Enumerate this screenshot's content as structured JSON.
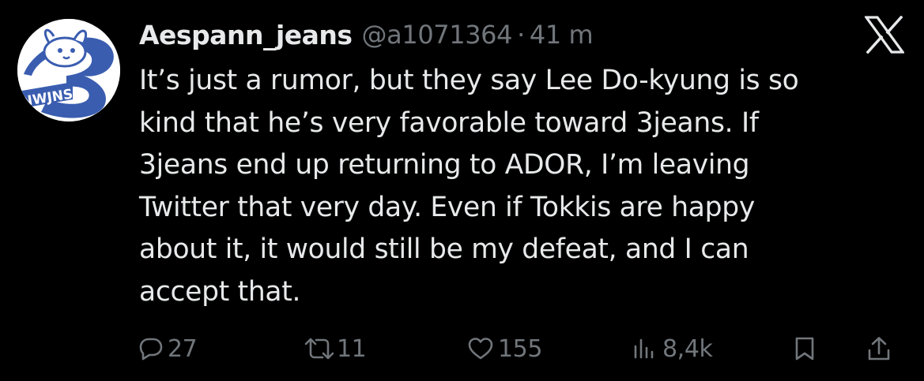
{
  "tweet": {
    "author": {
      "display_name": "Aespann_jeans",
      "handle": "@a1071364",
      "separator": "·",
      "time": "41 m",
      "avatar_icon": "rabbit-logo-avatar",
      "avatar_text": "NWJNS"
    },
    "platform_icon": "x-logo-icon",
    "text": "It’s just a rumor, but they say Lee Do-kyung is so\nkind that he’s very favorable toward 3jeans. If\n3jeans end up returning to ADOR, I’m leaving\nTwitter that very day. Even if Tokkis are happy\nabout it, it would still be my defeat, and I can\naccept that.",
    "actions": {
      "reply": {
        "icon": "reply-icon",
        "count": "27"
      },
      "repost": {
        "icon": "repost-icon",
        "count": "11"
      },
      "like": {
        "icon": "heart-icon",
        "count": "155"
      },
      "views": {
        "icon": "views-icon",
        "count": "8,4k"
      },
      "bookmark": {
        "icon": "bookmark-icon"
      },
      "share": {
        "icon": "share-icon"
      }
    }
  },
  "colors": {
    "background": "#000000",
    "primary_text": "#e7e9ea",
    "secondary_text": "#71767b",
    "avatar_blue": "#3a5db0"
  }
}
